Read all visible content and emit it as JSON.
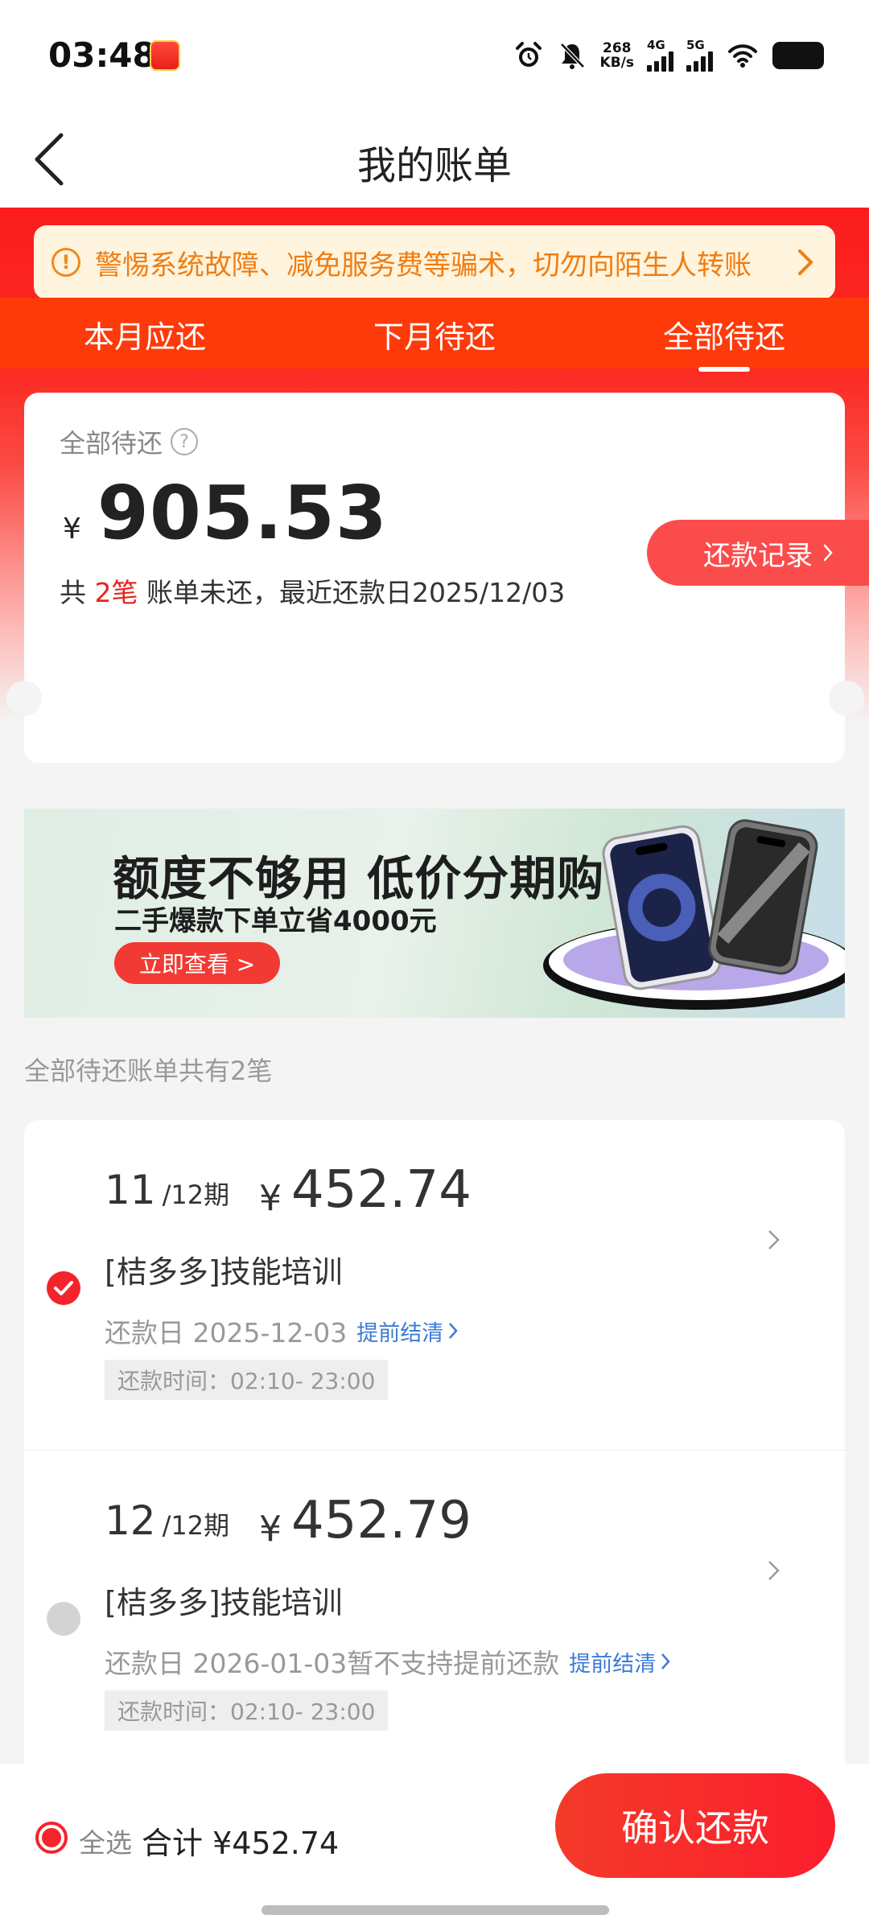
{
  "status_bar": {
    "time": "03:48",
    "net_speed_value": "268",
    "net_speed_unit": "KB/s",
    "signal_1_label": "4G",
    "signal_2_label": "5G",
    "icons": [
      "alarm-icon",
      "mute-bell-icon",
      "wifi-icon",
      "battery-icon"
    ]
  },
  "nav": {
    "title": "我的账单"
  },
  "notice": {
    "text": "警惕系统故障、减免服务费等骗术，切勿向陌生人转账"
  },
  "tabs": [
    {
      "label": "本月应还",
      "active": false
    },
    {
      "label": "下月待还",
      "active": false
    },
    {
      "label": "全部待还",
      "active": true
    }
  ],
  "summary": {
    "label": "全部待还",
    "currency": "¥",
    "amount": "905.53",
    "bills_prefix": "共 ",
    "bills_count": "2笔",
    "bills_suffix": " 账单未还，最近还款日2025/12/03",
    "record_button": "还款记录"
  },
  "banner": {
    "headline": "额度不够用 低价分期购",
    "subline": "二手爆款下单立省4000元",
    "cta": "立即查看 >"
  },
  "list_header": "全部待还账单共有2笔",
  "bills": [
    {
      "selected": true,
      "period": "11",
      "period_total": "/12期",
      "currency": "¥",
      "amount": "452.74",
      "name": "[桔多多]技能培训",
      "due": "还款日 2025-12-03",
      "note": "",
      "early_settle": "提前结清",
      "repay_time": "还款时间：02:10- 23:00"
    },
    {
      "selected": false,
      "period": "12",
      "period_total": "/12期",
      "currency": "¥",
      "amount": "452.79",
      "name": "[桔多多]技能培训",
      "due": "还款日 2026-01-03",
      "note": " 暂不支持提前还款",
      "early_settle": "提前结清",
      "repay_time": "还款时间：02:10- 23:00"
    }
  ],
  "bottom": {
    "select_all": "全选",
    "total": "合计 ¥452.74",
    "confirm": "确认还款"
  },
  "colors": {
    "brand_red": "#fb1d1d",
    "notice_orange": "#f07d12",
    "link_blue": "#3b7bd6"
  }
}
